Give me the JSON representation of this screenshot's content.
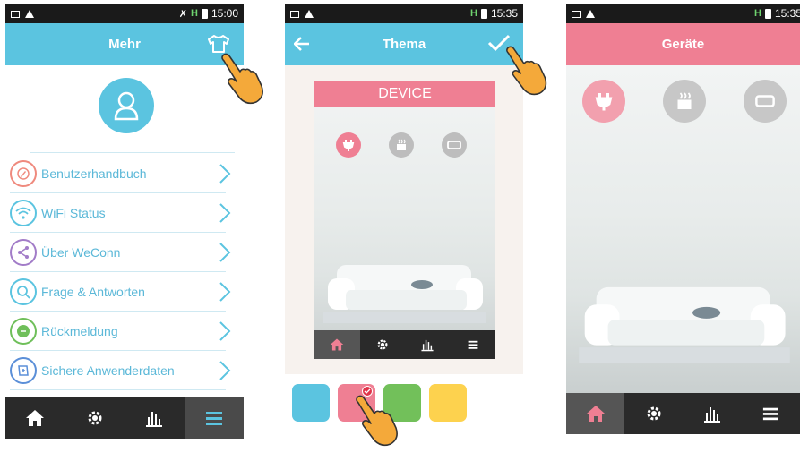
{
  "screen1": {
    "status": {
      "time": "15:00"
    },
    "title": "Mehr",
    "menu": [
      {
        "label": "Benutzerhandbuch",
        "icon": "compass-icon",
        "color": "#ef8a7e"
      },
      {
        "label": "WiFi Status",
        "icon": "wifi-icon",
        "color": "#5bc4e0"
      },
      {
        "label": "Über WeConn",
        "icon": "share-icon",
        "color": "#a27cc8"
      },
      {
        "label": "Frage & Antworten",
        "icon": "search-icon",
        "color": "#5bc4e0"
      },
      {
        "label": "Rückmeldung",
        "icon": "chat-icon",
        "color": "#6fbf5a"
      },
      {
        "label": "Sichere Anwenderdaten",
        "icon": "backup-icon",
        "color": "#5b8fd8"
      }
    ],
    "nav": [
      "home-icon",
      "gear-icon",
      "chart-icon",
      "menu-icon"
    ],
    "active_nav": 3
  },
  "screen2": {
    "status": {
      "time": "15:35"
    },
    "title": "Thema",
    "preview_title": "DEVICE",
    "theme_colors": [
      "#5bc4e0",
      "#ef7f93",
      "#72c05a",
      "#fdd24e"
    ],
    "selected_theme": 1
  },
  "screen3": {
    "status": {
      "time": "15:35"
    },
    "title": "Geräte"
  },
  "colors": {
    "blue": "#5bc4e0",
    "pink": "#ef7f93",
    "hand": "#f4a93a"
  }
}
